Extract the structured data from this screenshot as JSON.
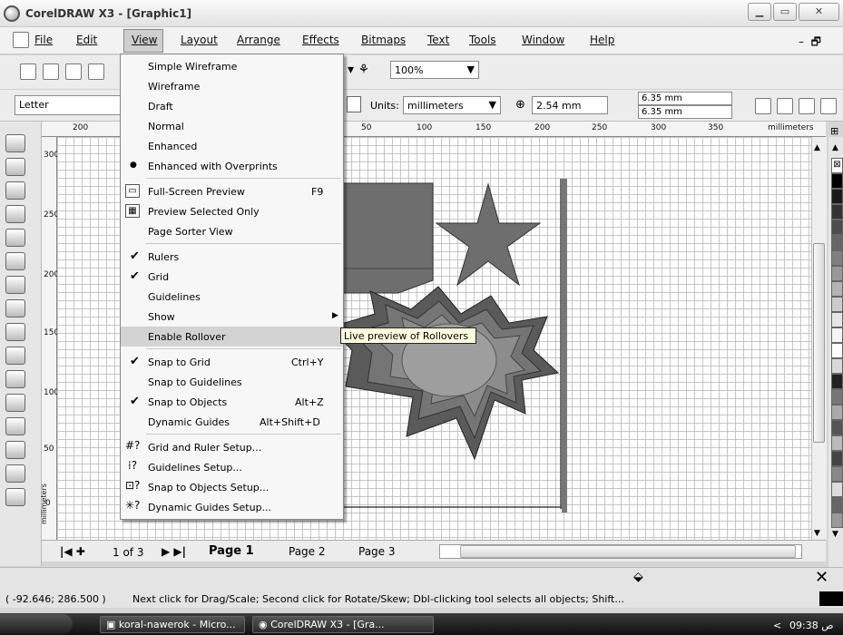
{
  "window": {
    "title": "CorelDRAW X3 - [Graphic1]"
  },
  "menubar": {
    "items": [
      "File",
      "Edit",
      "View",
      "Layout",
      "Arrange",
      "Effects",
      "Bitmaps",
      "Text",
      "Tools",
      "Window",
      "Help"
    ]
  },
  "toolbar": {
    "zoom_value": "100%"
  },
  "propertybar": {
    "paper_size": "Letter",
    "units_label": "Units:",
    "units_value": "millimeters",
    "nudge_value": "2.54 mm",
    "dup_x": "6.35 mm",
    "dup_y": "6.35 mm"
  },
  "rulers": {
    "h_ticks": [
      "200",
      "50",
      "100",
      "150",
      "200",
      "250",
      "300",
      "350"
    ],
    "h_units": "millimeters",
    "v_ticks": [
      "300",
      "250",
      "200",
      "150",
      "100",
      "50",
      "0"
    ],
    "v_units": "millimeters"
  },
  "view_menu": {
    "items": [
      {
        "label": "Simple Wireframe",
        "shortcut": "",
        "mark": ""
      },
      {
        "label": "Wireframe",
        "shortcut": "",
        "mark": ""
      },
      {
        "label": "Draft",
        "shortcut": "",
        "mark": ""
      },
      {
        "label": "Normal",
        "shortcut": "",
        "mark": ""
      },
      {
        "label": "Enhanced",
        "shortcut": "",
        "mark": ""
      },
      {
        "label": "Enhanced with Overprints",
        "shortcut": "",
        "mark": "●"
      },
      {
        "label": "Full-Screen Preview",
        "shortcut": "F9",
        "mark": ""
      },
      {
        "label": "Preview Selected Only",
        "shortcut": "",
        "mark": ""
      },
      {
        "label": "Page Sorter View",
        "shortcut": "",
        "mark": ""
      },
      {
        "label": "Rulers",
        "shortcut": "",
        "mark": "✔"
      },
      {
        "label": "Grid",
        "shortcut": "",
        "mark": "✔"
      },
      {
        "label": "Guidelines",
        "shortcut": "",
        "mark": ""
      },
      {
        "label": "Show",
        "shortcut": "",
        "mark": ""
      },
      {
        "label": "Enable Rollover",
        "shortcut": "",
        "mark": ""
      },
      {
        "label": "Snap to Grid",
        "shortcut": "Ctrl+Y",
        "mark": "✔"
      },
      {
        "label": "Snap to Guidelines",
        "shortcut": "",
        "mark": ""
      },
      {
        "label": "Snap to Objects",
        "shortcut": "Alt+Z",
        "mark": "✔"
      },
      {
        "label": "Dynamic Guides",
        "shortcut": "Alt+Shift+D",
        "mark": ""
      },
      {
        "label": "Grid and Ruler Setup...",
        "shortcut": "",
        "mark": ""
      },
      {
        "label": "Guidelines Setup...",
        "shortcut": "",
        "mark": ""
      },
      {
        "label": "Snap to Objects Setup...",
        "shortcut": "",
        "mark": ""
      },
      {
        "label": "Dynamic Guides Setup...",
        "shortcut": "",
        "mark": ""
      }
    ],
    "tooltip": "Live preview of Rollovers"
  },
  "pages": {
    "counter": "1 of 3",
    "tabs": [
      "Page 1",
      "Page 2",
      "Page 3"
    ]
  },
  "status": {
    "coordinates": "( -92.646; 286.500 )",
    "hint": "Next click for Drag/Scale; Second click for Rotate/Skew; Dbl-clicking tool selects all objects; Shift..."
  },
  "taskbar": {
    "tasks": [
      "koral-nawerok - Micro...",
      "CorelDRAW X3 - [Gra..."
    ],
    "clock": "09:38 ص"
  },
  "colors": {
    "grid": "#c6c6c6",
    "shape_dark": "#6e6e6e",
    "shape_mid": "#8a8a8a"
  }
}
